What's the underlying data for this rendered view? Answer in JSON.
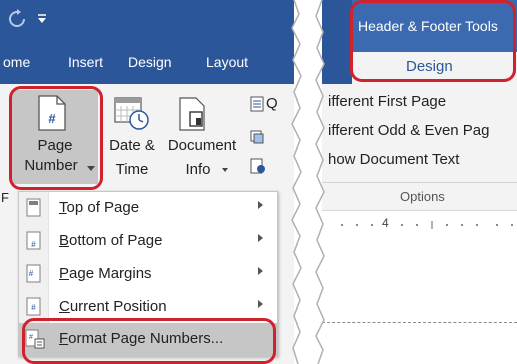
{
  "left": {
    "tabs": [
      "ome",
      "Insert",
      "Design",
      "Layout"
    ],
    "ribbon": {
      "page_number": [
        "Page",
        "Number"
      ],
      "date_time": [
        "Date &",
        "Time"
      ],
      "document_info": [
        "Document",
        "Info"
      ],
      "quick_parts_initial": "Q",
      "ruler_initial": "F"
    },
    "menu": [
      {
        "label": "Top of Page",
        "has_arrow": true
      },
      {
        "label": "Bottom of Page",
        "has_arrow": true
      },
      {
        "label": "Page Margins",
        "has_arrow": true
      },
      {
        "label": "Current Position",
        "has_arrow": true
      },
      {
        "label": "Format Page Numbers...",
        "has_arrow": false
      }
    ]
  },
  "right": {
    "contextual_title": "Header & Footer Tools",
    "contextual_tab": "Design",
    "options": [
      "ifferent First Page",
      "ifferent Odd & Even Pag",
      "how Document Text"
    ],
    "group_label": "Options",
    "ruler_number": "4"
  },
  "colors": {
    "accent": "#2b579a",
    "callout": "#d0222c",
    "menu_highlight": "#c6c6c6"
  }
}
